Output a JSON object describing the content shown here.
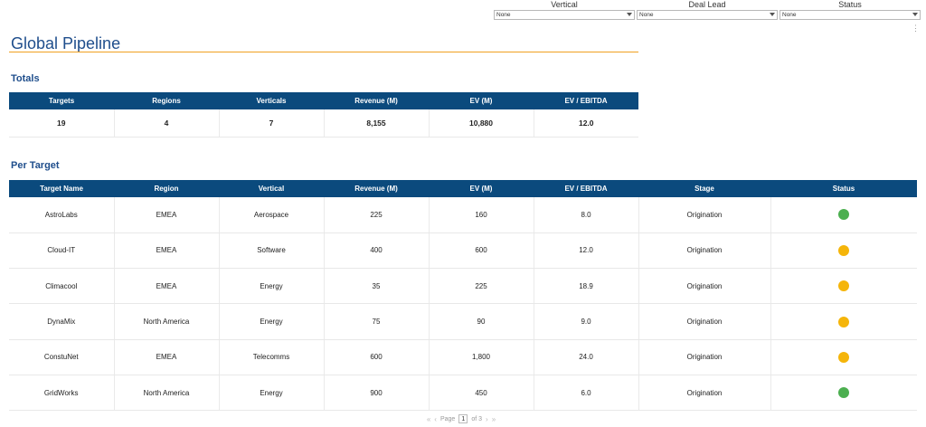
{
  "filters": [
    {
      "label": "Vertical",
      "value": "None"
    },
    {
      "label": "Deal Lead",
      "value": "None"
    },
    {
      "label": "Status",
      "value": "None"
    }
  ],
  "title": "Global Pipeline",
  "totals": {
    "heading": "Totals",
    "columns": [
      "Targets",
      "Regions",
      "Verticals",
      "Revenue (M)",
      "EV (M)",
      "EV / EBITDA"
    ],
    "values": [
      "19",
      "4",
      "7",
      "8,155",
      "10,880",
      "12.0"
    ]
  },
  "per_target": {
    "heading": "Per Target",
    "columns": [
      "Target Name",
      "Region",
      "Vertical",
      "Revenue (M)",
      "EV (M)",
      "EV / EBITDA",
      "Stage",
      "Status"
    ],
    "rows": [
      {
        "name": "AstroLabs",
        "region": "EMEA",
        "vertical": "Aerospace",
        "revenue": "225",
        "ev": "160",
        "ev_ebitda": "8.0",
        "stage": "Origination",
        "status": "green"
      },
      {
        "name": "Cloud-IT",
        "region": "EMEA",
        "vertical": "Software",
        "revenue": "400",
        "ev": "600",
        "ev_ebitda": "12.0",
        "stage": "Origination",
        "status": "amber"
      },
      {
        "name": "Climacool",
        "region": "EMEA",
        "vertical": "Energy",
        "revenue": "35",
        "ev": "225",
        "ev_ebitda": "18.9",
        "stage": "Origination",
        "status": "amber"
      },
      {
        "name": "DynaMix",
        "region": "North America",
        "vertical": "Energy",
        "revenue": "75",
        "ev": "90",
        "ev_ebitda": "9.0",
        "stage": "Origination",
        "status": "amber"
      },
      {
        "name": "ConstuNet",
        "region": "EMEA",
        "vertical": "Telecomms",
        "revenue": "600",
        "ev": "1,800",
        "ev_ebitda": "24.0",
        "stage": "Origination",
        "status": "amber"
      },
      {
        "name": "GridWorks",
        "region": "North America",
        "vertical": "Energy",
        "revenue": "900",
        "ev": "450",
        "ev_ebitda": "6.0",
        "stage": "Origination",
        "status": "green"
      }
    ]
  },
  "status_colors": {
    "green": "#4caf50",
    "amber": "#f5b50a"
  },
  "pager": {
    "page_label": "Page",
    "page": "1",
    "of_label": "of 3",
    "first_icon": "«",
    "prev_icon": "‹",
    "next_icon": "›",
    "last_icon": "»"
  }
}
